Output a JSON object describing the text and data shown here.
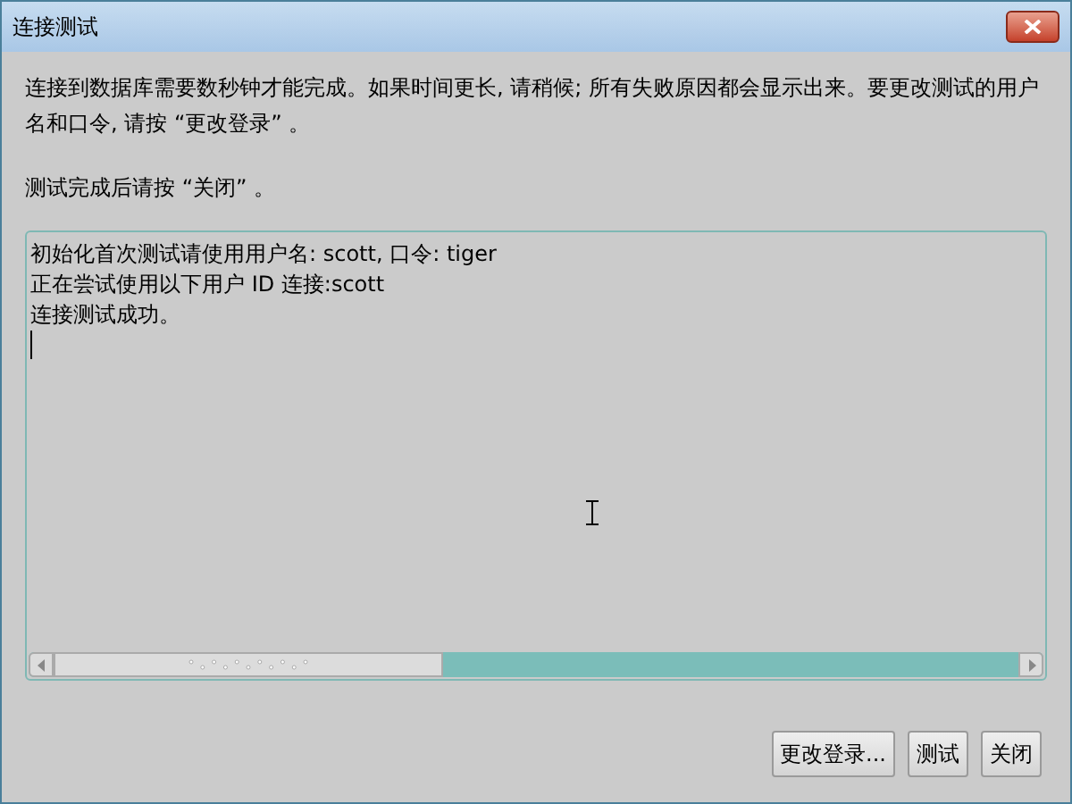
{
  "window": {
    "title": "连接测试"
  },
  "instructions": [
    "连接到数据库需要数秒钟才能完成。如果时间更长, 请稍候; 所有失败原因都会显示出来。要更改测试的用户名和口令, 请按 “更改登录” 。",
    "测试完成后请按 “关闭” 。"
  ],
  "log": [
    "初始化首次测试请使用用户名: scott, 口令: tiger",
    "正在尝试使用以下用户 ID 连接:scott",
    "连接测试成功。"
  ],
  "buttons": [
    "更改登录...",
    "测试",
    "关闭"
  ]
}
